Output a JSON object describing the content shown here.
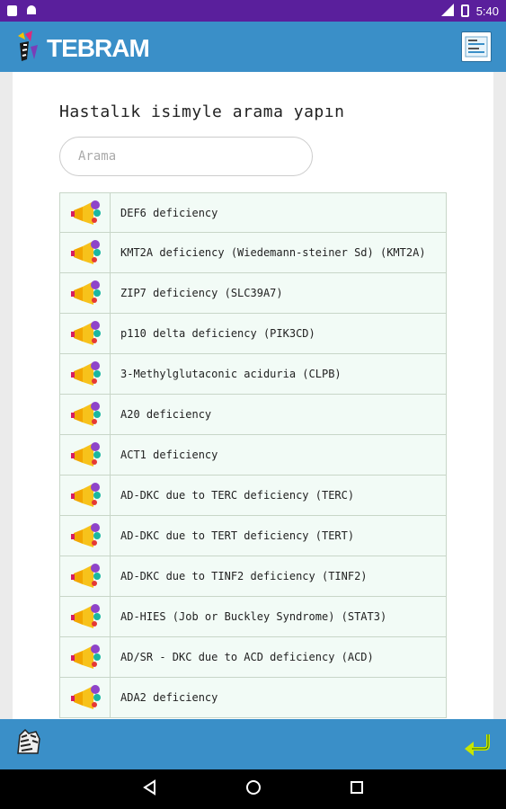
{
  "status_bar": {
    "time": "5:40"
  },
  "app_bar": {
    "logo_text": "TEBRAM"
  },
  "main": {
    "heading": "Hastalık isimyle arama yapın",
    "search_placeholder": "Arama",
    "items": [
      {
        "label": "DEF6 deficiency"
      },
      {
        "label": "KMT2A deficiency (Wiedemann-steiner Sd) (KMT2A)"
      },
      {
        "label": "ZIP7 deficiency (SLC39A7)"
      },
      {
        "label": "p110 delta deficiency (PIK3CD)"
      },
      {
        "label": "3-Methylglutaconic aciduria (CLPB)"
      },
      {
        "label": "A20 deficiency"
      },
      {
        "label": "ACT1 deficiency"
      },
      {
        "label": "AD-DKC due to TERC deficiency (TERC)"
      },
      {
        "label": "AD-DKC due to TERT deficiency (TERT)"
      },
      {
        "label": "AD-DKC due to TINF2 deficiency (TINF2)"
      },
      {
        "label": "AD-HIES (Job or Buckley Syndrome) (STAT3)"
      },
      {
        "label": "AD/SR - DKC due to ACD deficiency (ACD)"
      },
      {
        "label": "ADA2 deficiency"
      }
    ]
  },
  "icons": {
    "row": "megaphone-icon",
    "menu": "document-menu-icon",
    "bottom_left": "zebra-icon",
    "bottom_right": "return-arrow-icon"
  },
  "colors": {
    "status_bar": "#5a1f9c",
    "app_bar": "#3a8fc8",
    "row_background": "#f2fbf6"
  }
}
